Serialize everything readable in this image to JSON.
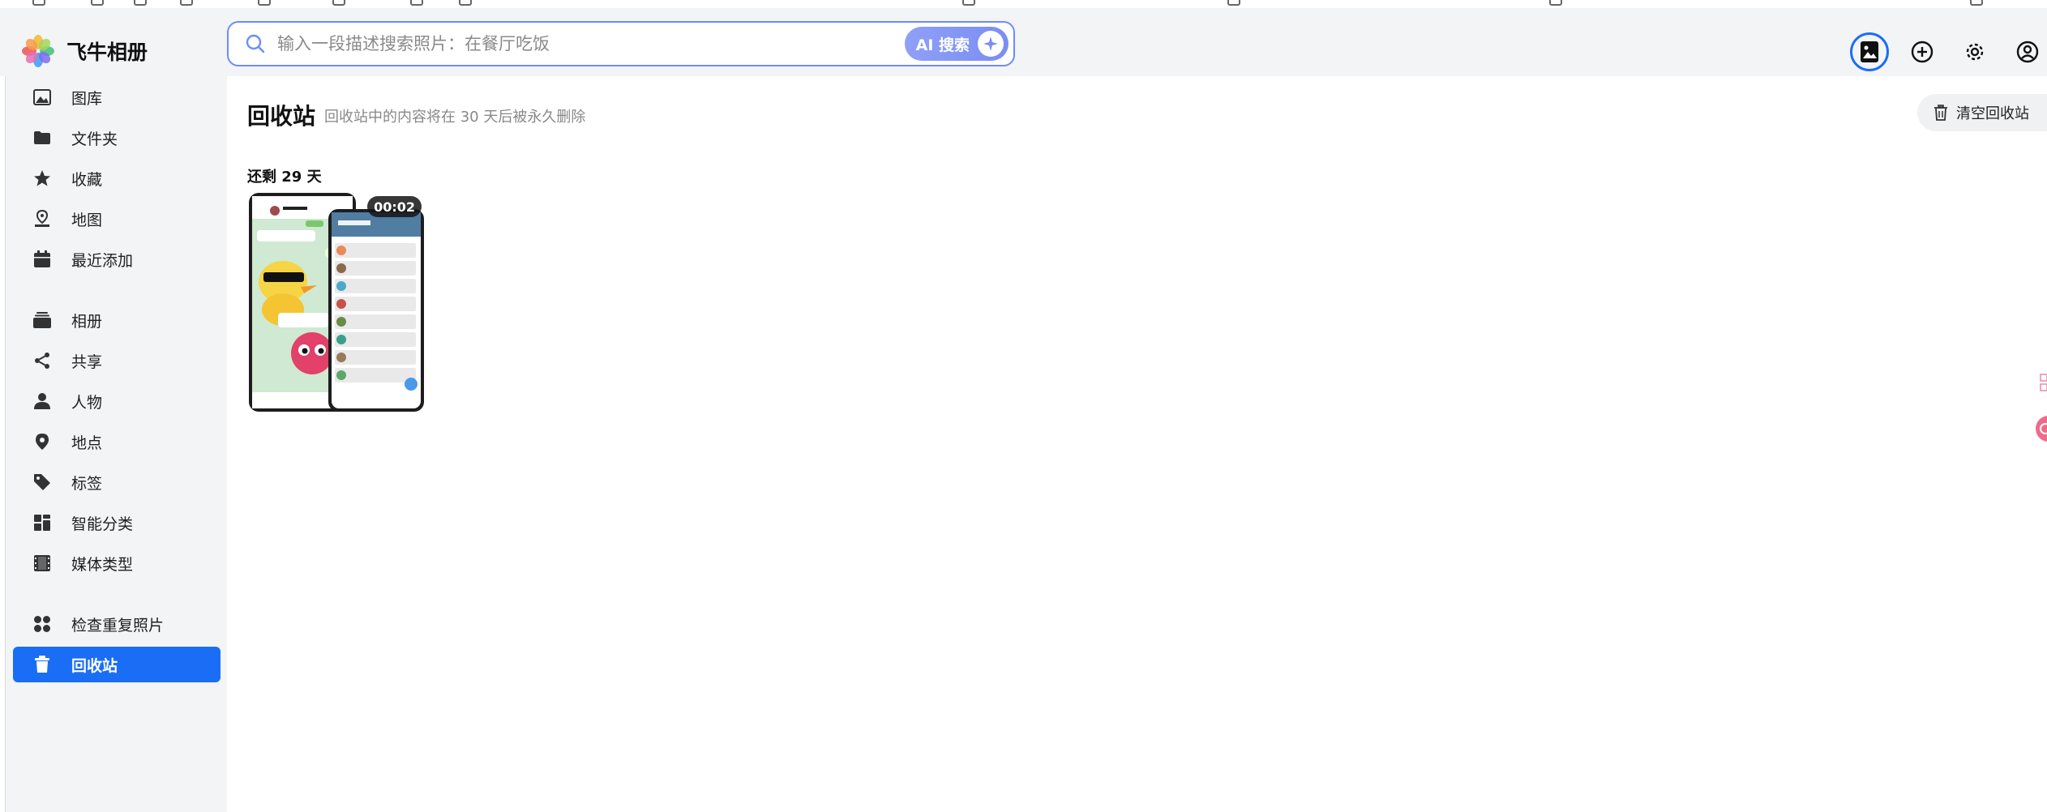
{
  "app": {
    "name": "飞牛相册"
  },
  "search": {
    "placeholder": "输入一段描述搜索照片：在餐厅吃饭",
    "ai_button_label": "AI 搜索"
  },
  "top_actions": [
    {
      "icon": "photo-upload-icon",
      "active": true
    },
    {
      "icon": "plus-circle-icon",
      "active": false
    },
    {
      "icon": "gear-icon",
      "active": false
    },
    {
      "icon": "user-circle-icon",
      "active": false
    }
  ],
  "sidebar": {
    "items": [
      {
        "label": "图库",
        "icon": "image-icon",
        "active": false
      },
      {
        "label": "文件夹",
        "icon": "folder-icon",
        "active": false
      },
      {
        "label": "收藏",
        "icon": "star-icon",
        "active": false
      },
      {
        "label": "地图",
        "icon": "map-pin-icon",
        "active": false
      },
      {
        "label": "最近添加",
        "icon": "calendar-icon",
        "active": false
      },
      {
        "label": "相册",
        "icon": "album-stack-icon",
        "active": false
      },
      {
        "label": "共享",
        "icon": "share-icon",
        "active": false
      },
      {
        "label": "人物",
        "icon": "person-icon",
        "active": false
      },
      {
        "label": "地点",
        "icon": "location-icon",
        "active": false
      },
      {
        "label": "标签",
        "icon": "tag-icon",
        "active": false
      },
      {
        "label": "智能分类",
        "icon": "grid-category-icon",
        "active": false
      },
      {
        "label": "媒体类型",
        "icon": "film-icon",
        "active": false
      },
      {
        "label": "检查重复照片",
        "icon": "duplicate-icon",
        "active": false
      },
      {
        "label": "回收站",
        "icon": "trash-icon",
        "active": true
      }
    ]
  },
  "main": {
    "title": "回收站",
    "subtitle": "回收站中的内容将在 30 天后被永久删除",
    "clear_button_label": "清空回收站",
    "groups": [
      {
        "label": "还剩 29 天",
        "items": [
          {
            "type": "video",
            "duration": "00:02"
          }
        ]
      }
    ]
  },
  "colors": {
    "accent": "#1a6ef5",
    "sidebar_bg": "#f3f4f6",
    "search_border": "#6c8cff"
  }
}
